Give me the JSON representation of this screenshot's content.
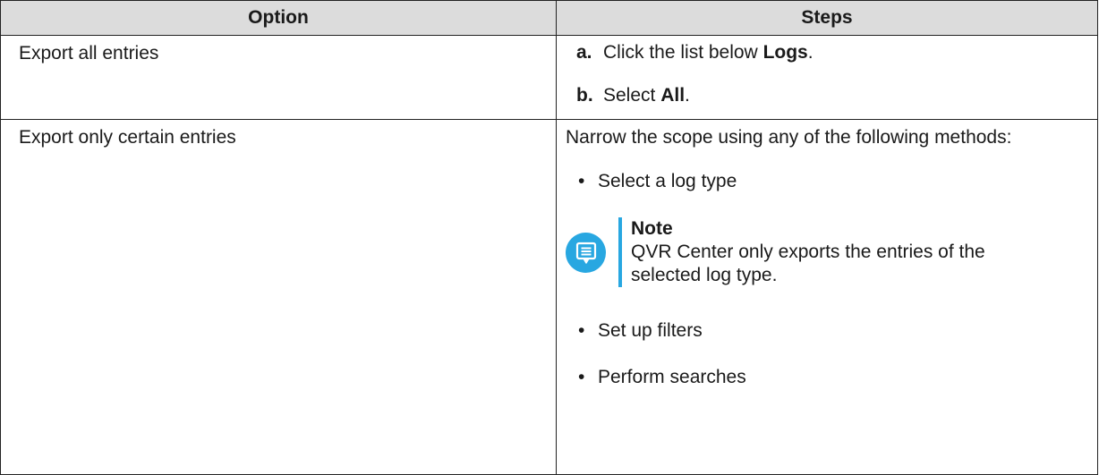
{
  "table": {
    "headers": {
      "option": "Option",
      "steps": "Steps"
    },
    "rows": [
      {
        "option": "Export all entries",
        "steps": {
          "a_letter": "a.",
          "a_pre": "Click the list below ",
          "a_bold": "Logs",
          "a_post": ".",
          "b_letter": "b.",
          "b_pre": "Select ",
          "b_bold": "All",
          "b_post": "."
        }
      },
      {
        "option": "Export only certain entries",
        "steps": {
          "intro": "Narrow the scope using any of the following methods:",
          "bullets": [
            "Select a log type",
            "Set up filters",
            "Perform searches"
          ],
          "bullet_glyph": "•",
          "note": {
            "icon": "note-icon",
            "title": "Note",
            "text": "QVR Center only exports the entries of the selected log type."
          }
        }
      }
    ]
  },
  "colors": {
    "header_bg": "#dcdcdc",
    "note_accent": "#28a7e1",
    "border": "#222222"
  }
}
